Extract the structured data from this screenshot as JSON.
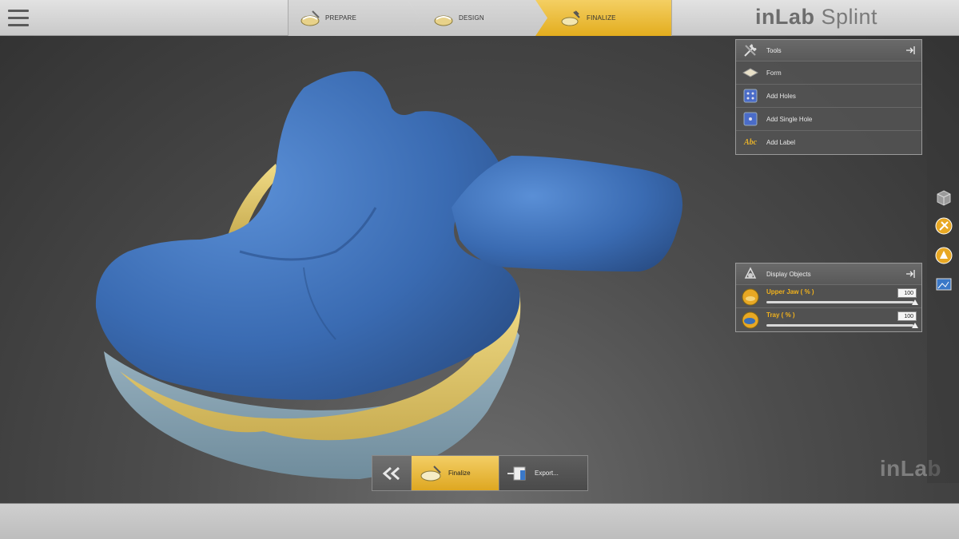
{
  "app": {
    "brand_light": "inLab",
    "brand_product": "Splint",
    "watermark": "inLab"
  },
  "steps": [
    {
      "label": "PREPARE",
      "icon": "jaw-scan-icon",
      "active": false
    },
    {
      "label": "DESIGN",
      "icon": "jaw-design-icon",
      "active": false
    },
    {
      "label": "FINALIZE",
      "icon": "jaw-finalize-icon",
      "active": true
    }
  ],
  "tools_panel": {
    "title": "Tools",
    "items": [
      {
        "label": "Form",
        "icon": "form-icon"
      },
      {
        "label": "Add Holes",
        "icon": "add-holes-icon"
      },
      {
        "label": "Add Single Hole",
        "icon": "add-single-hole-icon"
      },
      {
        "label": "Add Label",
        "icon": "add-label-icon"
      }
    ]
  },
  "display_panel": {
    "title": "Display Objects",
    "objects": [
      {
        "label": "Upper Jaw  ( % )",
        "value": "100",
        "level": 1.0,
        "icon": "upper-jaw-icon"
      },
      {
        "label": "Tray  ( % )",
        "value": "100",
        "level": 1.0,
        "icon": "tray-icon"
      }
    ]
  },
  "bottom_nav": {
    "back": "back-double-chevron-icon",
    "finalize": "Finalize",
    "export": "Export..."
  },
  "colors": {
    "accent": "#e8b22a",
    "tray_blue": "#3b6fb6",
    "jaw_yellow": "#e6cf73",
    "base_blue": "#8ba8b8"
  }
}
